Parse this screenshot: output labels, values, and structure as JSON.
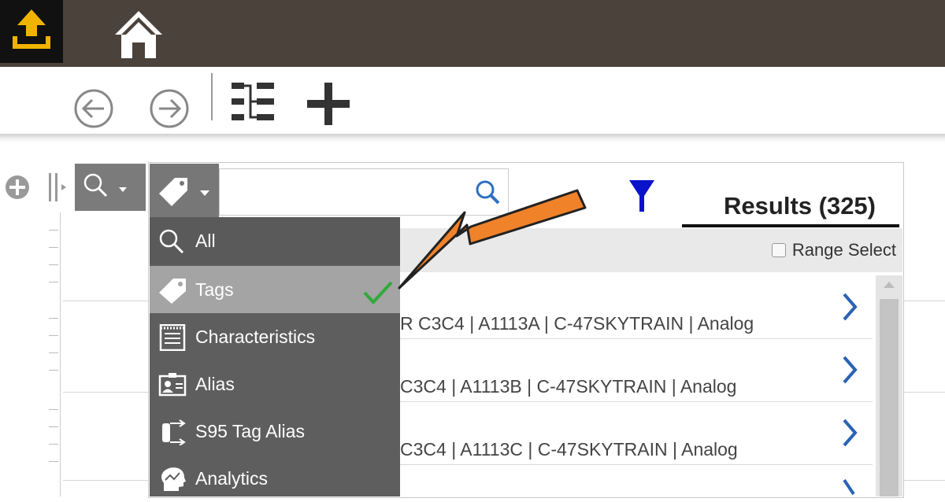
{
  "search": {
    "placeholder": "",
    "value": ""
  },
  "results": {
    "title": "Results (325)",
    "range_select": "Range Select"
  },
  "dropdown": {
    "items": [
      {
        "label": "All",
        "icon": "search-icon"
      },
      {
        "label": "Tags",
        "icon": "tag-icon",
        "selected": true
      },
      {
        "label": "Characteristics",
        "icon": "notepad-icon"
      },
      {
        "label": "Alias",
        "icon": "id-card-icon"
      },
      {
        "label": "S95 Tag Alias",
        "icon": "s95-alias-icon"
      },
      {
        "label": "Analytics",
        "icon": "analytics-head-icon"
      }
    ]
  },
  "result_rows": [
    {
      "text": "R C3C4 | A1113A | C-47SKYTRAIN | Analog"
    },
    {
      "text": "C3C4 | A1113B | C-47SKYTRAIN | Analog"
    },
    {
      "text": "C3C4 | A1113C | C-47SKYTRAIN | Analog"
    }
  ],
  "colors": {
    "topbar": "#4b423c",
    "upload_accent": "#f0b400",
    "filter": "#0a12cc",
    "arrow": "#f0822a",
    "check": "#2faa3a",
    "chevron": "#2a62b5"
  }
}
